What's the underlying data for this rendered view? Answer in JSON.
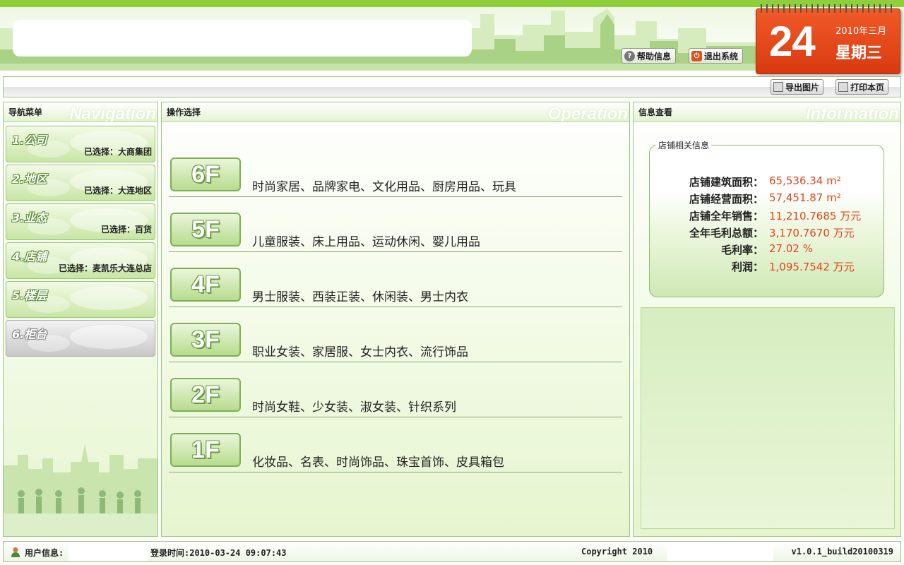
{
  "header": {
    "help_label": "帮助信息",
    "exit_label": "退出系统",
    "calendar": {
      "day": "24",
      "year_month": "2010年三月",
      "weekday": "星期三"
    }
  },
  "toolbar": {
    "export_label": "导出图片",
    "print_label": "打印本页"
  },
  "nav": {
    "title": "导航菜单",
    "watermark": "Navigation",
    "items": [
      {
        "label": "1.公司",
        "selected": "已选择：大商集团"
      },
      {
        "label": "2.地区",
        "selected": "已选择：大连地区"
      },
      {
        "label": "3.业态",
        "selected": "已选择：百货"
      },
      {
        "label": "4.店铺",
        "selected": "已选择：麦凯乐大连总店"
      },
      {
        "label": "5.楼层",
        "selected": ""
      },
      {
        "label": "6.柜台",
        "selected": ""
      }
    ]
  },
  "operation": {
    "title": "操作选择",
    "watermark": "Operation",
    "floors": [
      {
        "floor": "6F",
        "desc": "时尚家居、品牌家电、文化用品、厨房用品、玩具"
      },
      {
        "floor": "5F",
        "desc": "儿童服装、床上用品、运动休闲、婴儿用品"
      },
      {
        "floor": "4F",
        "desc": "男士服装、西装正装、休闲装、男士内衣"
      },
      {
        "floor": "3F",
        "desc": "职业女装、家居服、女士内衣、流行饰品"
      },
      {
        "floor": "2F",
        "desc": "时尚女鞋、少女装、淑女装、针织系列"
      },
      {
        "floor": "1F",
        "desc": "化妆品、名表、时尚饰品、珠宝首饰、皮具箱包"
      }
    ]
  },
  "info": {
    "title": "信息查看",
    "watermark": "Information",
    "box_title": "店铺相关信息",
    "rows": [
      {
        "key": "店铺建筑面积：",
        "value": "65,536.34 m²"
      },
      {
        "key": "店铺经营面积：",
        "value": "57,451.87 m²"
      },
      {
        "key": "店铺全年销售：",
        "value": "11,210.7685 万元"
      },
      {
        "key": "全年毛利总额：",
        "value": "3,170.7670 万元"
      },
      {
        "key": "毛利率：",
        "value": "27.02 %"
      },
      {
        "key": "利润：",
        "value": "1,095.7542 万元"
      }
    ]
  },
  "footer": {
    "user_label": "用户信息:",
    "login_time": "登录时间:2010-03-24 09:07:43",
    "copyright": "Copyright 2010",
    "version": "v1.0.1_build20100319"
  }
}
